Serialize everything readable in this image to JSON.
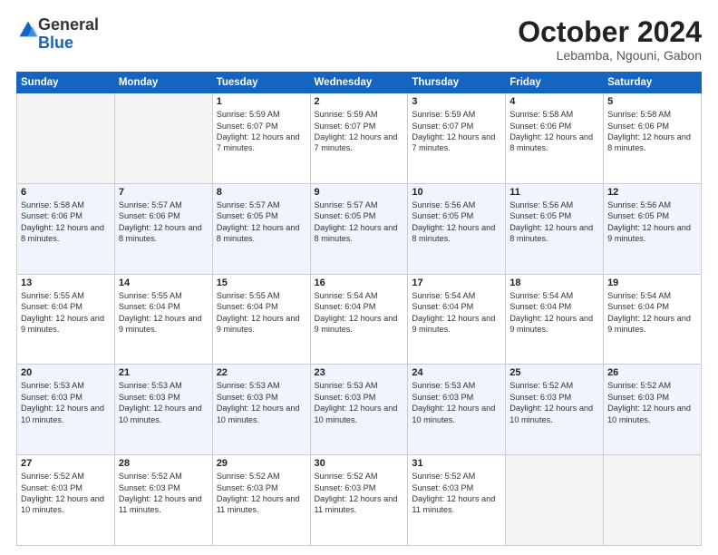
{
  "header": {
    "logo": {
      "general": "General",
      "blue": "Blue"
    },
    "title": "October 2024",
    "location": "Lebamba, Ngouni, Gabon"
  },
  "days": [
    "Sunday",
    "Monday",
    "Tuesday",
    "Wednesday",
    "Thursday",
    "Friday",
    "Saturday"
  ],
  "weeks": [
    [
      {
        "day": "",
        "empty": true
      },
      {
        "day": "",
        "empty": true
      },
      {
        "day": "1",
        "sunrise": "5:59 AM",
        "sunset": "6:07 PM",
        "daylight": "12 hours and 7 minutes."
      },
      {
        "day": "2",
        "sunrise": "5:59 AM",
        "sunset": "6:07 PM",
        "daylight": "12 hours and 7 minutes."
      },
      {
        "day": "3",
        "sunrise": "5:59 AM",
        "sunset": "6:07 PM",
        "daylight": "12 hours and 7 minutes."
      },
      {
        "day": "4",
        "sunrise": "5:58 AM",
        "sunset": "6:06 PM",
        "daylight": "12 hours and 8 minutes."
      },
      {
        "day": "5",
        "sunrise": "5:58 AM",
        "sunset": "6:06 PM",
        "daylight": "12 hours and 8 minutes."
      }
    ],
    [
      {
        "day": "6",
        "sunrise": "5:58 AM",
        "sunset": "6:06 PM",
        "daylight": "12 hours and 8 minutes."
      },
      {
        "day": "7",
        "sunrise": "5:57 AM",
        "sunset": "6:06 PM",
        "daylight": "12 hours and 8 minutes."
      },
      {
        "day": "8",
        "sunrise": "5:57 AM",
        "sunset": "6:05 PM",
        "daylight": "12 hours and 8 minutes."
      },
      {
        "day": "9",
        "sunrise": "5:57 AM",
        "sunset": "6:05 PM",
        "daylight": "12 hours and 8 minutes."
      },
      {
        "day": "10",
        "sunrise": "5:56 AM",
        "sunset": "6:05 PM",
        "daylight": "12 hours and 8 minutes."
      },
      {
        "day": "11",
        "sunrise": "5:56 AM",
        "sunset": "6:05 PM",
        "daylight": "12 hours and 8 minutes."
      },
      {
        "day": "12",
        "sunrise": "5:56 AM",
        "sunset": "6:05 PM",
        "daylight": "12 hours and 9 minutes."
      }
    ],
    [
      {
        "day": "13",
        "sunrise": "5:55 AM",
        "sunset": "6:04 PM",
        "daylight": "12 hours and 9 minutes."
      },
      {
        "day": "14",
        "sunrise": "5:55 AM",
        "sunset": "6:04 PM",
        "daylight": "12 hours and 9 minutes."
      },
      {
        "day": "15",
        "sunrise": "5:55 AM",
        "sunset": "6:04 PM",
        "daylight": "12 hours and 9 minutes."
      },
      {
        "day": "16",
        "sunrise": "5:54 AM",
        "sunset": "6:04 PM",
        "daylight": "12 hours and 9 minutes."
      },
      {
        "day": "17",
        "sunrise": "5:54 AM",
        "sunset": "6:04 PM",
        "daylight": "12 hours and 9 minutes."
      },
      {
        "day": "18",
        "sunrise": "5:54 AM",
        "sunset": "6:04 PM",
        "daylight": "12 hours and 9 minutes."
      },
      {
        "day": "19",
        "sunrise": "5:54 AM",
        "sunset": "6:04 PM",
        "daylight": "12 hours and 9 minutes."
      }
    ],
    [
      {
        "day": "20",
        "sunrise": "5:53 AM",
        "sunset": "6:03 PM",
        "daylight": "12 hours and 10 minutes."
      },
      {
        "day": "21",
        "sunrise": "5:53 AM",
        "sunset": "6:03 PM",
        "daylight": "12 hours and 10 minutes."
      },
      {
        "day": "22",
        "sunrise": "5:53 AM",
        "sunset": "6:03 PM",
        "daylight": "12 hours and 10 minutes."
      },
      {
        "day": "23",
        "sunrise": "5:53 AM",
        "sunset": "6:03 PM",
        "daylight": "12 hours and 10 minutes."
      },
      {
        "day": "24",
        "sunrise": "5:53 AM",
        "sunset": "6:03 PM",
        "daylight": "12 hours and 10 minutes."
      },
      {
        "day": "25",
        "sunrise": "5:52 AM",
        "sunset": "6:03 PM",
        "daylight": "12 hours and 10 minutes."
      },
      {
        "day": "26",
        "sunrise": "5:52 AM",
        "sunset": "6:03 PM",
        "daylight": "12 hours and 10 minutes."
      }
    ],
    [
      {
        "day": "27",
        "sunrise": "5:52 AM",
        "sunset": "6:03 PM",
        "daylight": "12 hours and 10 minutes."
      },
      {
        "day": "28",
        "sunrise": "5:52 AM",
        "sunset": "6:03 PM",
        "daylight": "12 hours and 11 minutes."
      },
      {
        "day": "29",
        "sunrise": "5:52 AM",
        "sunset": "6:03 PM",
        "daylight": "12 hours and 11 minutes."
      },
      {
        "day": "30",
        "sunrise": "5:52 AM",
        "sunset": "6:03 PM",
        "daylight": "12 hours and 11 minutes."
      },
      {
        "day": "31",
        "sunrise": "5:52 AM",
        "sunset": "6:03 PM",
        "daylight": "12 hours and 11 minutes."
      },
      {
        "day": "",
        "empty": true
      },
      {
        "day": "",
        "empty": true
      }
    ]
  ]
}
